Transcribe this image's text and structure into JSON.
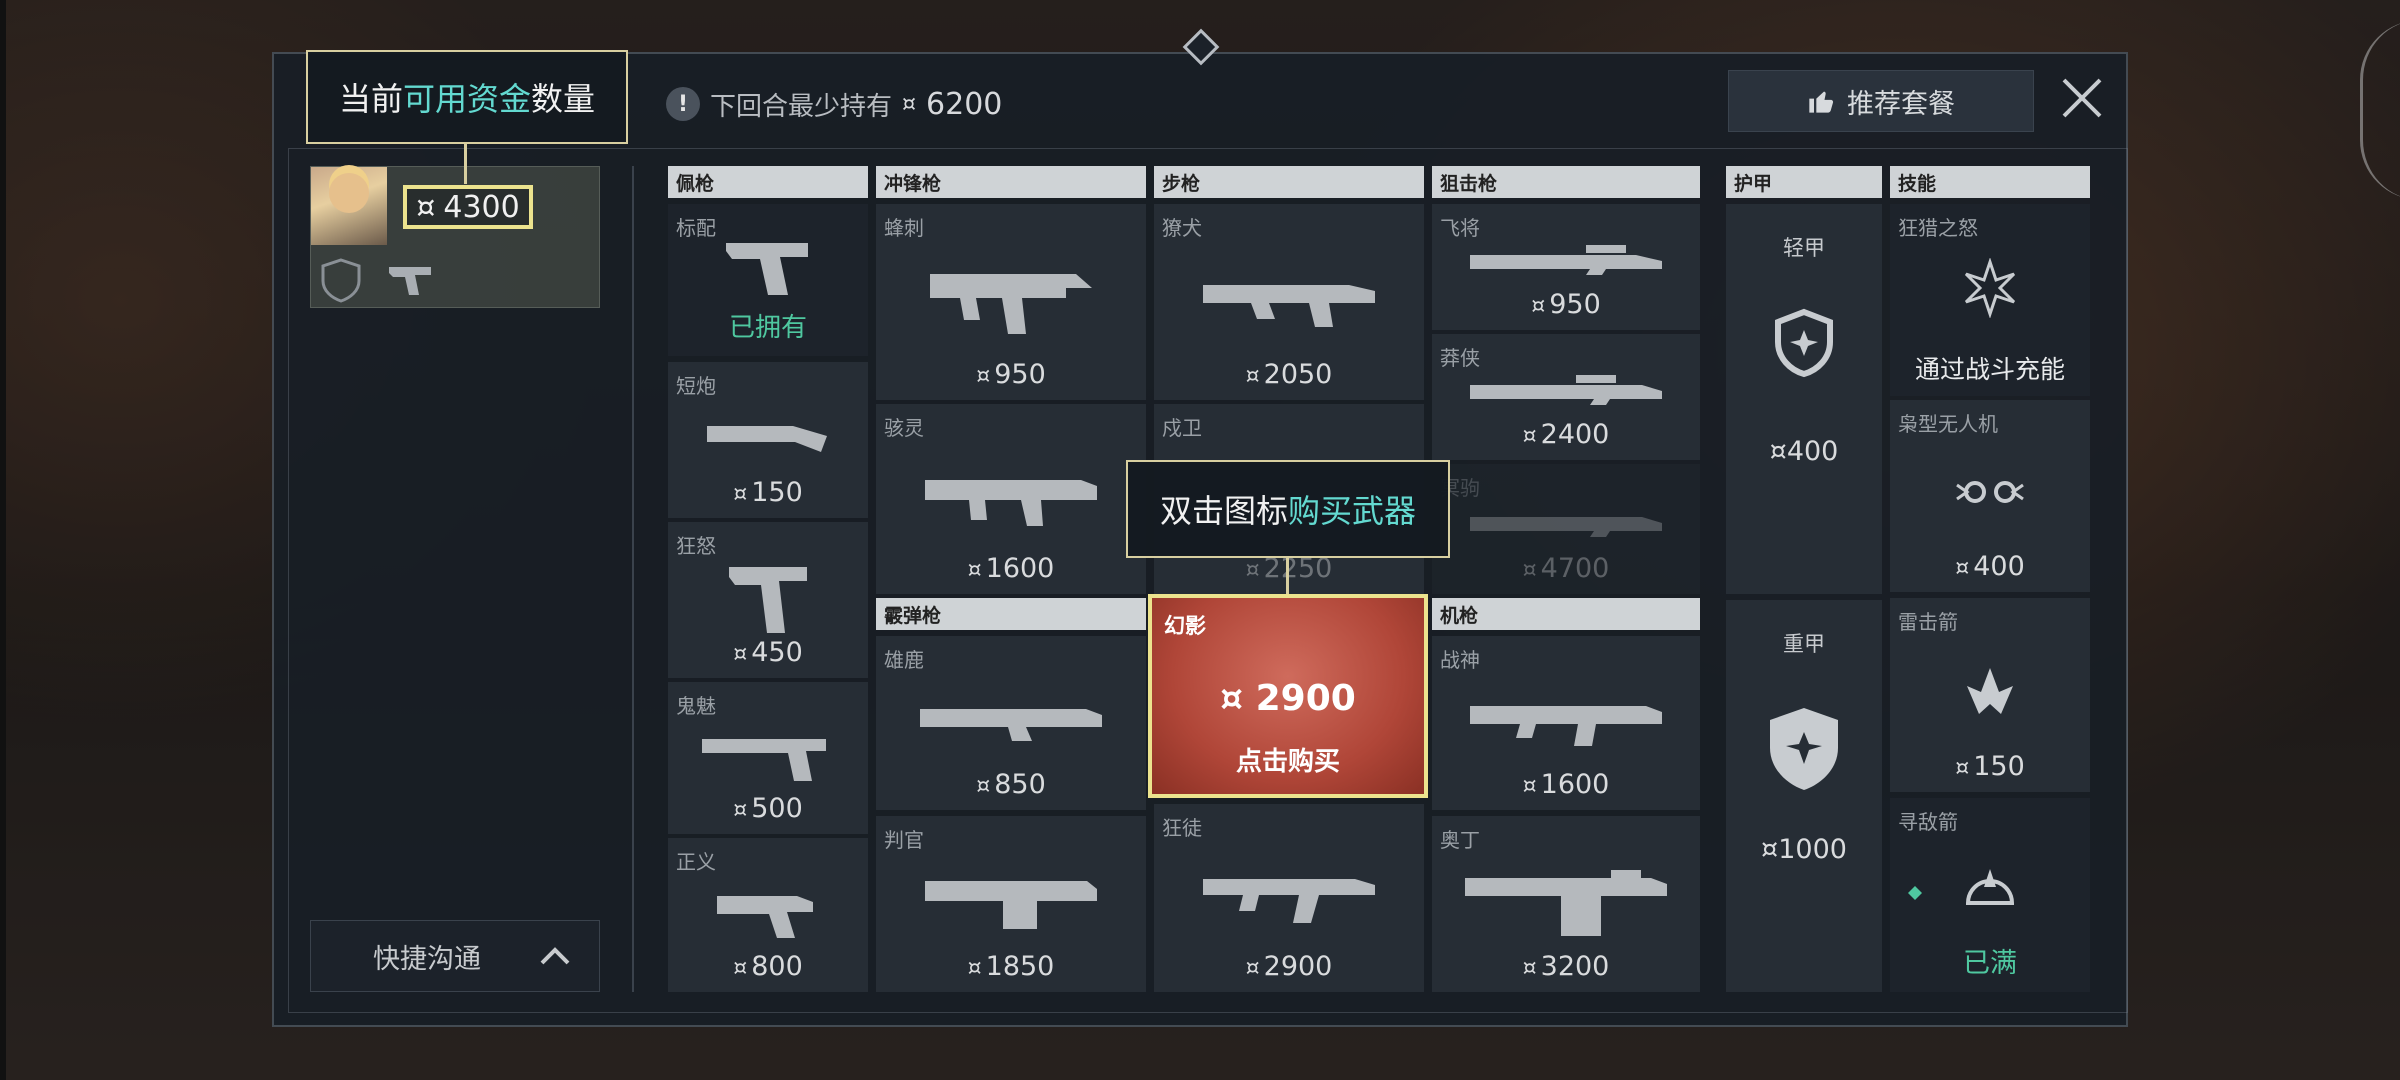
{
  "top_bar": {
    "min_hold_label": "下回合最少持有",
    "min_hold_value": "6200",
    "recommend_label": "推荐套餐"
  },
  "tooltips": {
    "funds_prefix": "当前",
    "funds_highlight": "可用资金",
    "funds_suffix": "数量",
    "buy_prefix": "双击图标",
    "buy_highlight": "购买武器"
  },
  "player": {
    "funds": "4300"
  },
  "quick_comm_label": "快捷沟通",
  "currency_symbol": "¤",
  "categories": {
    "sidearm": "佩枪",
    "smg": "冲锋枪",
    "rifle": "步枪",
    "sniper": "狙击枪",
    "shotgun": "霰弹枪",
    "machine_gun": "机枪",
    "armor": "护甲",
    "abilities": "技能"
  },
  "sidearms": [
    {
      "name": "标配",
      "status": "已拥有"
    },
    {
      "name": "短炮",
      "price": "150"
    },
    {
      "name": "狂怒",
      "price": "450"
    },
    {
      "name": "鬼魅",
      "price": "500"
    },
    {
      "name": "正义",
      "price": "800"
    }
  ],
  "smgs": [
    {
      "name": "蜂刺",
      "price": "950"
    },
    {
      "name": "骇灵",
      "price": "1600"
    }
  ],
  "shotguns": [
    {
      "name": "雄鹿",
      "price": "850"
    },
    {
      "name": "判官",
      "price": "1850"
    }
  ],
  "rifles": [
    {
      "name": "獠犬",
      "price": "2050"
    },
    {
      "name": "戍卫",
      "price": "2250"
    },
    {
      "name": "幻影",
      "price": "2900",
      "action": "点击购买"
    },
    {
      "name": "狂徒",
      "price": "2900"
    }
  ],
  "snipers": [
    {
      "name": "飞将",
      "price": "950"
    },
    {
      "name": "莽侠",
      "price": "2400"
    },
    {
      "name": "冥驹",
      "price": "4700"
    }
  ],
  "machine_guns": [
    {
      "name": "战神",
      "price": "1600"
    },
    {
      "name": "奥丁",
      "price": "3200"
    }
  ],
  "armor": [
    {
      "name": "轻甲",
      "price": "400"
    },
    {
      "name": "重甲",
      "price": "1000"
    }
  ],
  "abilities": [
    {
      "name": "狂猎之怒",
      "status": "通过战斗充能"
    },
    {
      "name": "枭型无人机",
      "price": "400"
    },
    {
      "name": "雷击箭",
      "price": "150"
    },
    {
      "name": "寻敌箭",
      "status": "已满"
    }
  ],
  "colors": {
    "highlight_border": "#ece38e",
    "accent_teal": "#63d9d0",
    "owned_green": "#4fc8a0",
    "featured_red": "#b04638"
  }
}
